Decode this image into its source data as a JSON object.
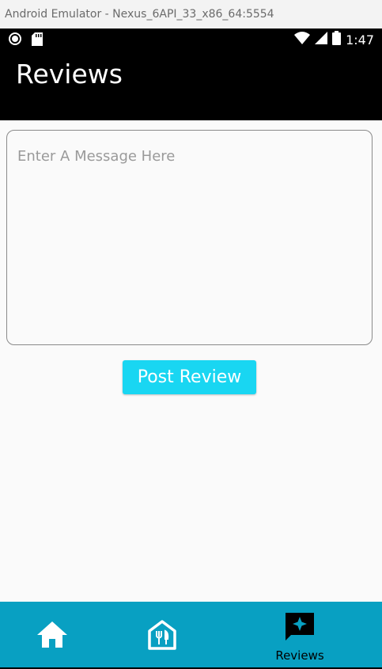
{
  "window": {
    "title": "Android Emulator - Nexus_6API_33_x86_64:5554"
  },
  "status_bar": {
    "time": "1:47",
    "icons": [
      "record-icon",
      "sd-card-icon",
      "wifi-icon",
      "signal-icon",
      "battery-icon"
    ]
  },
  "app_bar": {
    "title": "Reviews"
  },
  "form": {
    "message_placeholder": "Enter A Message Here",
    "message_value": "",
    "post_label": "Post Review"
  },
  "bottom_nav": {
    "items": [
      {
        "icon": "home-icon",
        "label": ""
      },
      {
        "icon": "restaurant-icon",
        "label": ""
      },
      {
        "icon": "reviews-icon",
        "label": "Reviews",
        "selected": true
      }
    ]
  },
  "colors": {
    "app_bar": "#000000",
    "button": "#19d6f2",
    "bottom_nav": "#08a0c2"
  }
}
